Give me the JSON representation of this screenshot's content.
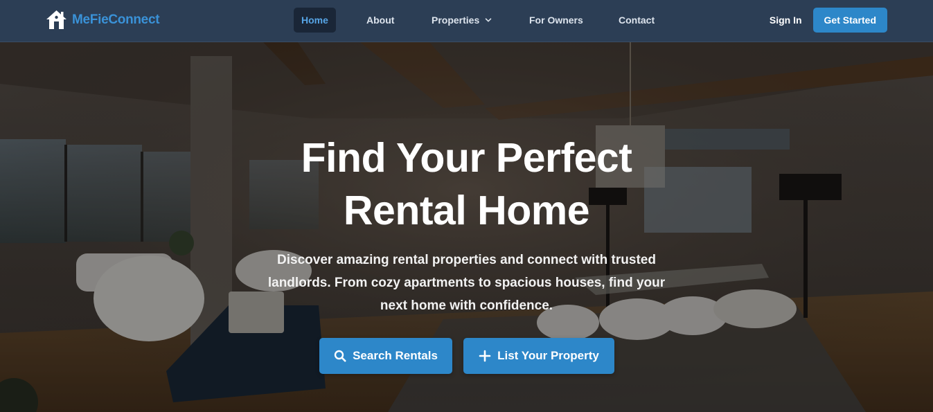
{
  "brand": {
    "name": "MeFieConnect",
    "icon": "house-icon",
    "color": "#3a92d8"
  },
  "nav": {
    "items": [
      {
        "label": "Home",
        "active": true
      },
      {
        "label": "About",
        "active": false
      },
      {
        "label": "Properties",
        "active": false,
        "dropdown": true
      },
      {
        "label": "For Owners",
        "active": false
      },
      {
        "label": "Contact",
        "active": false
      }
    ],
    "sign_in": "Sign In",
    "get_started": "Get Started"
  },
  "hero": {
    "title_line1": "Find Your Perfect",
    "title_line2": "Rental Home",
    "subtitle_line1": "Discover amazing rental properties and connect with trusted",
    "subtitle_line2": "landlords. From cozy apartments to spacious houses, find your",
    "subtitle_line3": "next home with confidence.",
    "search_button": "Search Rentals",
    "search_icon": "search-icon",
    "list_button": "List Your Property",
    "list_icon": "plus-icon"
  },
  "colors": {
    "navbar_bg": "#2c3e55",
    "accent": "#2d87c9",
    "active_nav_bg": "#1a2637",
    "active_nav_text": "#57a5e6"
  }
}
